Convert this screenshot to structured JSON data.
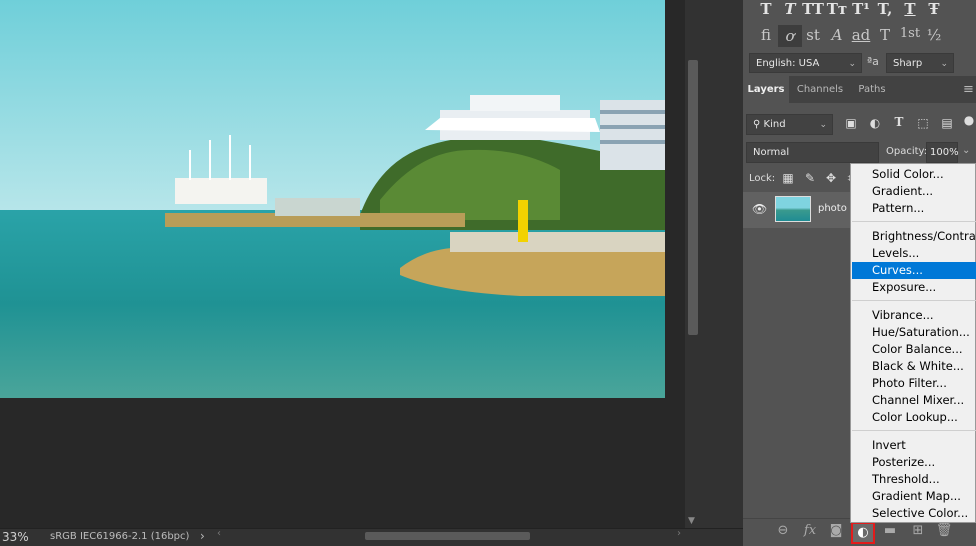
{
  "canvas": {
    "zoom": "33%",
    "profile": "sRGB IEC61966-2.1 (16bpc)",
    "status_arrow": "›"
  },
  "character": {
    "style_row1": [
      "T",
      "T",
      "TT",
      "Tт",
      "T¹",
      "T,",
      "T",
      "Ŧ"
    ],
    "style_row2": [
      "fi",
      "ơ",
      "st",
      "A",
      "ad",
      "T",
      "1st",
      "½"
    ],
    "language": "English: USA",
    "aa_label": "ªa",
    "antialias": "Sharp"
  },
  "layers_panel": {
    "tabs": [
      "Layers",
      "Channels",
      "Paths"
    ],
    "menu_icon": "≡",
    "kind_label": "Kind",
    "blend_mode": "Normal",
    "opacity_label": "Opacity:",
    "opacity_value": "100%",
    "lock_label": "Lock:",
    "layer_name": "photo"
  },
  "adjustment_menu": {
    "groups": [
      [
        "Solid Color...",
        "Gradient...",
        "Pattern..."
      ],
      [
        "Brightness/Contrast...",
        "Levels...",
        "Curves...",
        "Exposure..."
      ],
      [
        "Vibrance...",
        "Hue/Saturation...",
        "Color Balance...",
        "Black & White...",
        "Photo Filter...",
        "Channel Mixer...",
        "Color Lookup..."
      ],
      [
        "Invert",
        "Posterize...",
        "Threshold...",
        "Gradient Map...",
        "Selective Color..."
      ]
    ],
    "highlighted": "Curves..."
  },
  "colors": {
    "highlight": "#0078d7",
    "focus_outline": "#e31b1b",
    "panel_bg": "#535353"
  }
}
